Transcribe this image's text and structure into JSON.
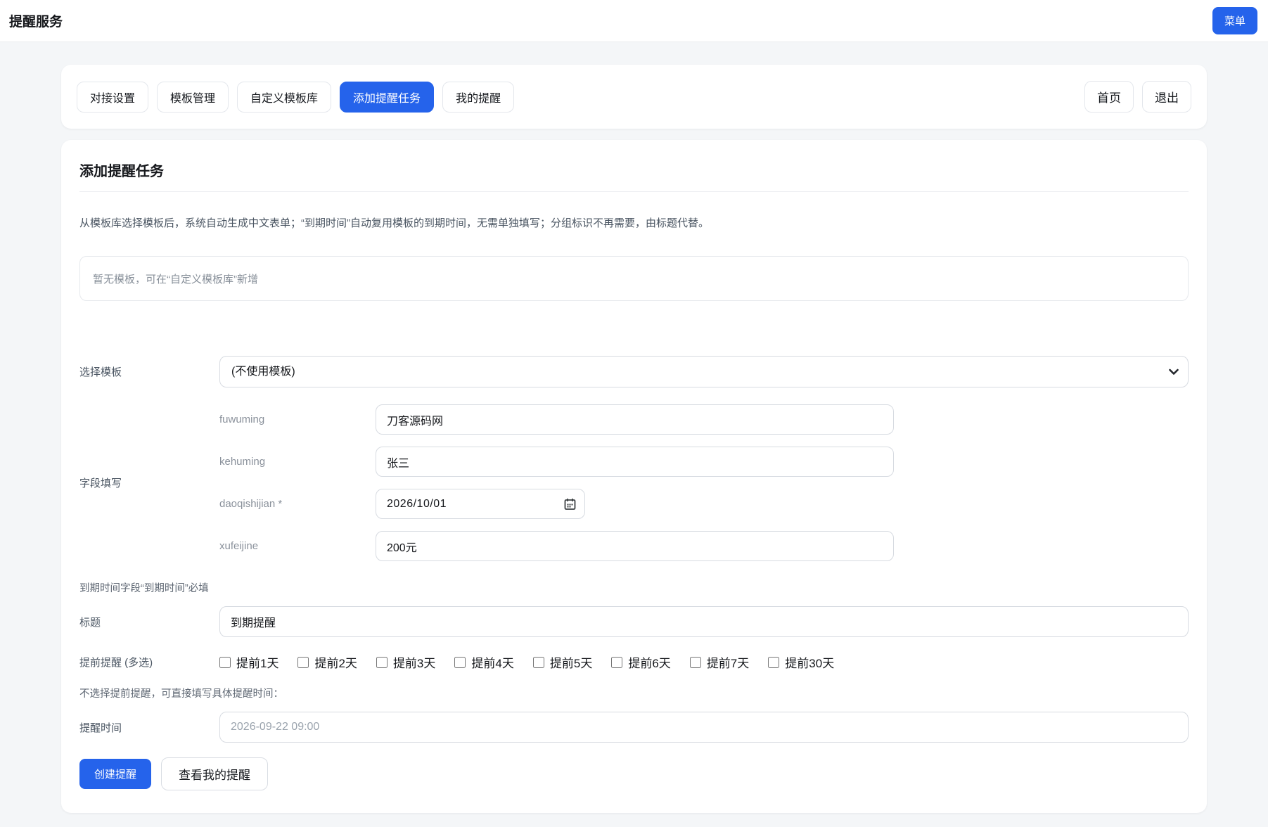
{
  "colors": {
    "accent": "#2563eb"
  },
  "header": {
    "title": "提醒服务",
    "menu_button": "菜单"
  },
  "nav": {
    "tabs": [
      {
        "label": "对接设置"
      },
      {
        "label": "模板管理"
      },
      {
        "label": "自定义模板库"
      },
      {
        "label": "添加提醒任务"
      },
      {
        "label": "我的提醒"
      }
    ],
    "home_button": "首页",
    "logout_button": "退出"
  },
  "main": {
    "title": "添加提醒任务",
    "description": "从模板库选择模板后，系统自动生成中文表单；“到期时间”自动复用模板的到期时间，无需单独填写；分组标识不再需要，由标题代替。",
    "notice": "暂无模板，可在“自定义模板库”新增",
    "form": {
      "template_label": "选择模板",
      "template_value": "(不使用模板)",
      "fields_label": "字段填写",
      "fields": [
        {
          "name": "fuwuming",
          "value": "刀客源码网"
        },
        {
          "name": "kehuming",
          "value": "张三"
        },
        {
          "name": "daoqishijian *",
          "value": "2026/10/01"
        },
        {
          "name": "xufeijine",
          "value": "200元"
        }
      ],
      "required_note": "到期时间字段“到期时间”必填",
      "title_label": "标题",
      "title_value": "到期提醒",
      "advance_label": "提前提醒 (多选)",
      "advance_options": [
        "提前1天",
        "提前2天",
        "提前3天",
        "提前4天",
        "提前5天",
        "提前6天",
        "提前7天",
        "提前30天"
      ],
      "advance_note": "不选择提前提醒，可直接填写具体提醒时间：",
      "time_label": "提醒时间",
      "time_placeholder": "2026-09-22 09:00",
      "create_button": "创建提醒",
      "view_button": "查看我的提醒"
    }
  }
}
